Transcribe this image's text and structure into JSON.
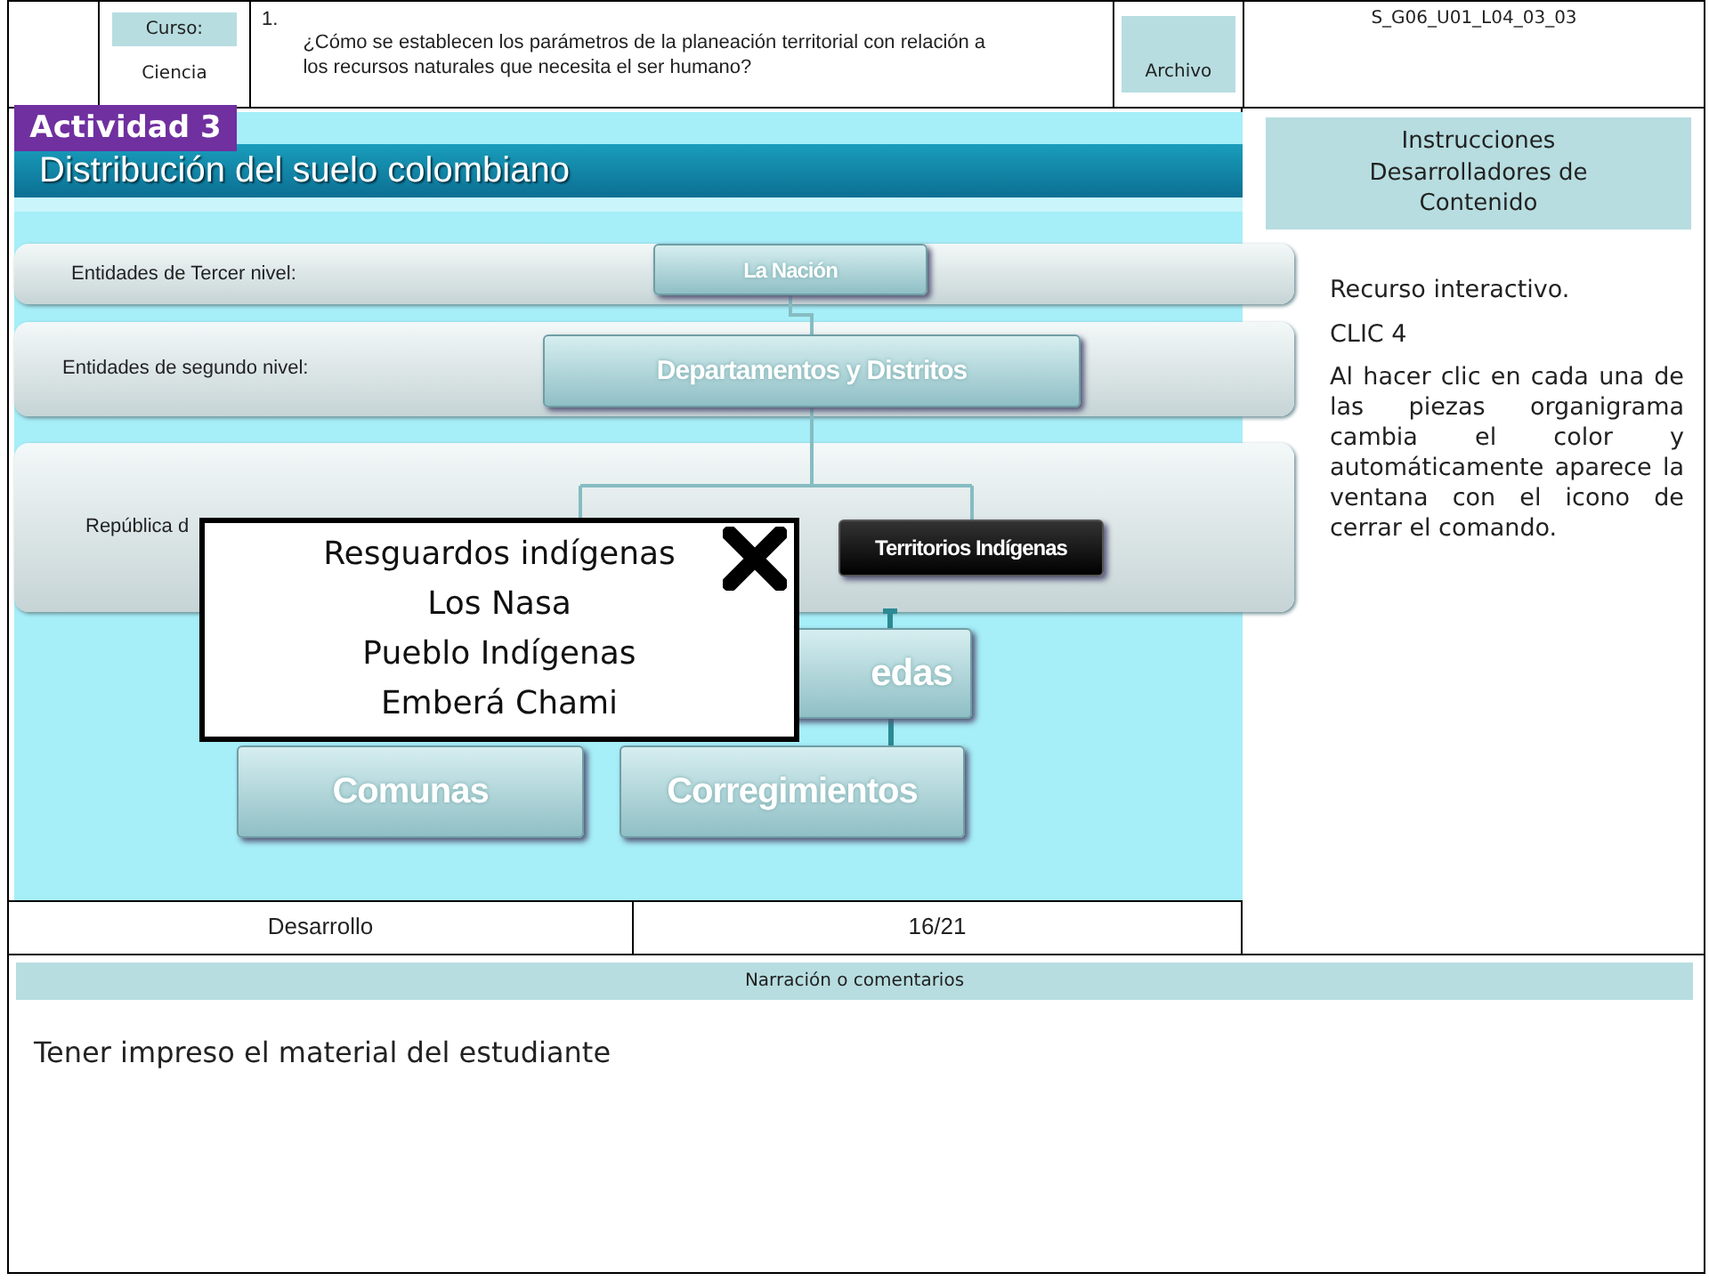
{
  "header": {
    "course_label": "Curso:",
    "course": "Ciencia",
    "question_number": "1.",
    "question": "¿Cómo se establecen los parámetros de la planeación territorial con relación a los recursos naturales que necesita el ser humano?",
    "file_label": "Archivo",
    "code": "S_G06_U01_L04_03_03"
  },
  "slide": {
    "badge": "Actividad 3",
    "title": "Distribución del suelo colombiano",
    "levels": [
      {
        "label": "Entidades de Tercer nivel:"
      },
      {
        "label": "Entidades de segundo nivel:"
      },
      {
        "label": "República d"
      }
    ],
    "nodes": [
      {
        "text": "La Nación",
        "selected": false
      },
      {
        "text": "Departamentos y Distritos",
        "selected": false
      },
      {
        "text": "Territorios Indígenas",
        "selected": true
      },
      {
        "text": "edas",
        "selected": false
      },
      {
        "text": "Comunas",
        "selected": false
      },
      {
        "text": "Corregimientos",
        "selected": false
      }
    ],
    "popup": {
      "lines": [
        "Resguardos indígenas",
        "Los Nasa",
        "Pueblo Indígenas",
        "Emberá Chami"
      ]
    }
  },
  "footer_row": {
    "section": "Desarrollo",
    "page": "16/21"
  },
  "instructions": {
    "title": "Instrucciones Desarrolladores de Contenido",
    "paragraphs": [
      "Recurso interactivo.",
      "CLIC 4",
      "Al hacer clic en cada una de las piezas organigrama cambia el color y automáticamente aparece la ventana con el icono de cerrar el comando."
    ]
  },
  "narration": {
    "title": "Narración o comentarios",
    "text": "Tener impreso el material del estudiante"
  }
}
